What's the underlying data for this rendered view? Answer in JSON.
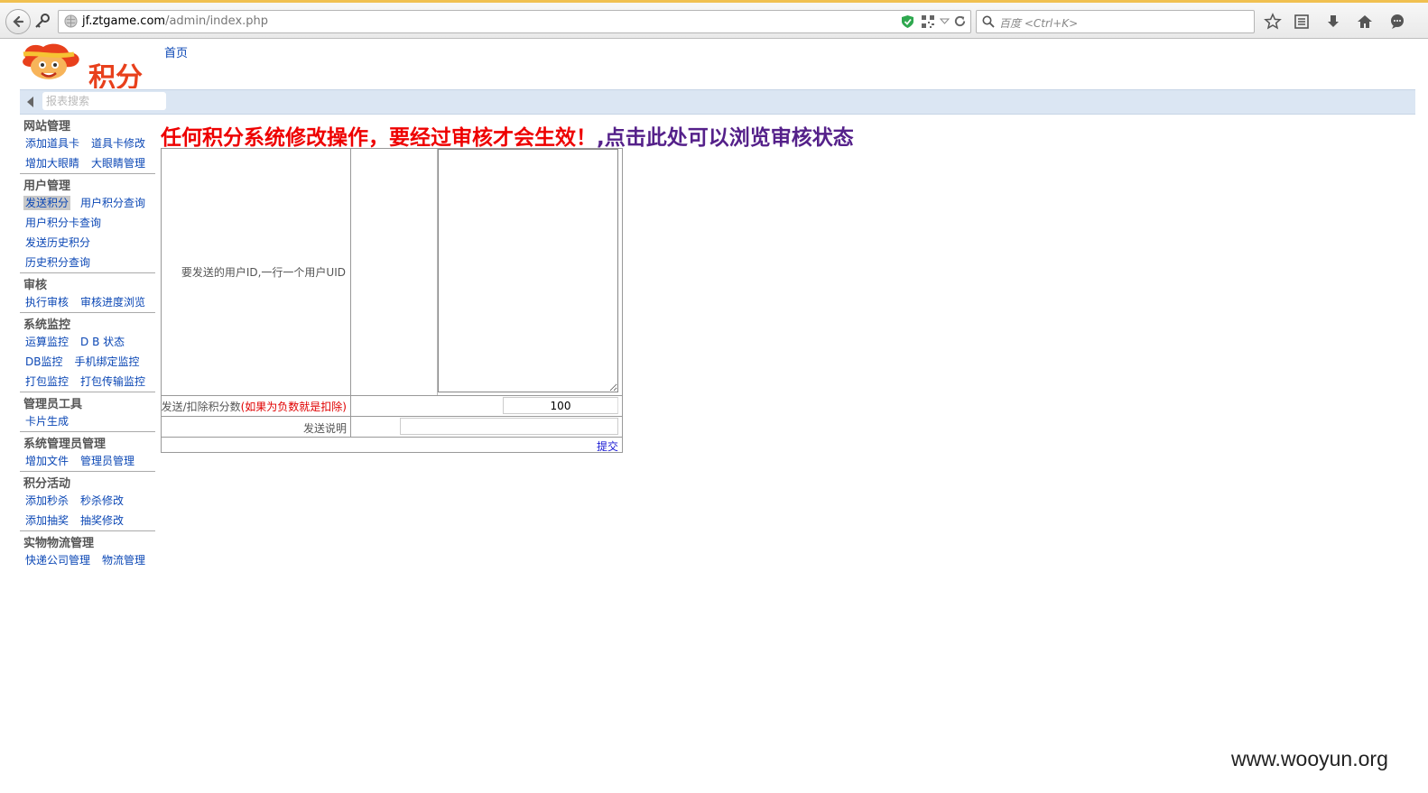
{
  "browser": {
    "url_host": "jf.ztgame.com",
    "url_path": "/admin/index.php",
    "search_placeholder": "百度 <Ctrl+K>"
  },
  "header": {
    "logo_text": "积分",
    "home_link": "首页",
    "menu_search_placeholder": "报表搜索"
  },
  "sidebar": {
    "sections": [
      {
        "title": "网站管理",
        "rows": [
          [
            "添加道具卡",
            "道具卡修改"
          ],
          [
            "增加大眼睛",
            "大眼睛管理"
          ]
        ]
      },
      {
        "title": "用户管理",
        "rows": [
          [
            "发送积分",
            "用户积分查询"
          ],
          [
            "用户积分卡查询"
          ],
          [
            "发送历史积分"
          ],
          [
            "历史积分查询"
          ]
        ]
      },
      {
        "title": "审核",
        "rows": [
          [
            "执行审核",
            "审核进度浏览"
          ]
        ]
      },
      {
        "title": "系统监控",
        "rows": [
          [
            "运算监控",
            "D B 状态"
          ],
          [
            "DB监控",
            "手机绑定监控"
          ],
          [
            "打包监控",
            "打包传输监控"
          ]
        ]
      },
      {
        "title": "管理员工具",
        "rows": [
          [
            "卡片生成"
          ]
        ]
      },
      {
        "title": "系统管理员管理",
        "rows": [
          [
            "增加文件",
            "管理员管理"
          ]
        ]
      },
      {
        "title": "积分活动",
        "rows": [
          [
            "添加秒杀",
            "秒杀修改"
          ],
          [
            "添加抽奖",
            "抽奖修改"
          ]
        ]
      },
      {
        "title": "实物物流管理",
        "rows": [
          [
            "快递公司管理",
            "物流管理"
          ]
        ]
      }
    ],
    "active_item": "发送积分"
  },
  "main": {
    "notice_red": "任何积分系统修改操作，要经过审核才会生效！",
    "notice_purple": ",点击此处可以浏览审核状态",
    "uid_label": "要发送的用户ID,一行一个用户UID",
    "uid_value": "",
    "score_label": "发送/扣除积分数",
    "score_hint": "(如果为负数就是扣除)",
    "score_value": "100",
    "desc_label": "发送说明",
    "desc_value": "",
    "submit_label": "提交"
  },
  "watermark": "www.wooyun.org"
}
